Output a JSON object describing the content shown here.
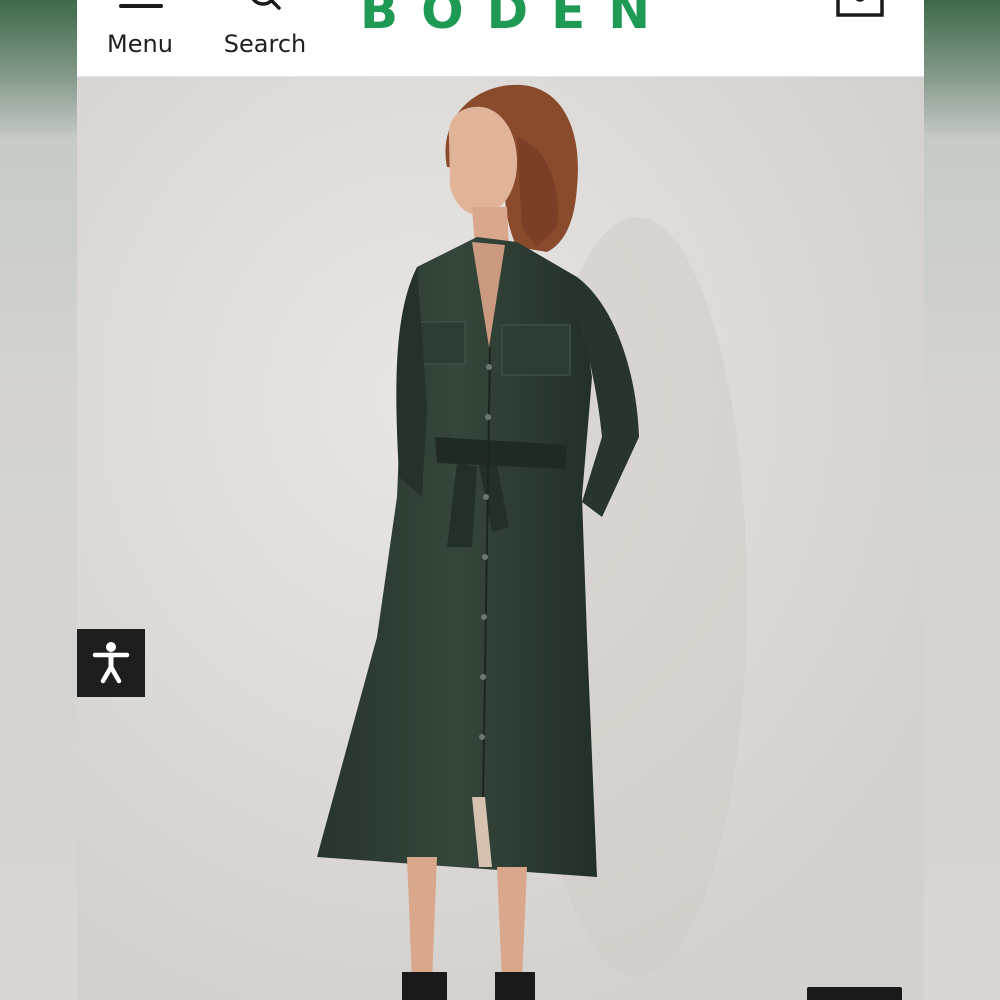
{
  "header": {
    "menu_label": "Menu",
    "search_label": "Search",
    "brand_logo": "BODEN",
    "brand_color": "#1f9a55"
  },
  "icons": {
    "menu": "hamburger-icon",
    "search": "search-icon",
    "bag": "shopping-bag-icon",
    "accessibility": "accessibility-icon"
  },
  "product_image": {
    "subject": "Model wearing dark green corduroy belted shirt dress",
    "dress_color": "#2b3a30"
  }
}
